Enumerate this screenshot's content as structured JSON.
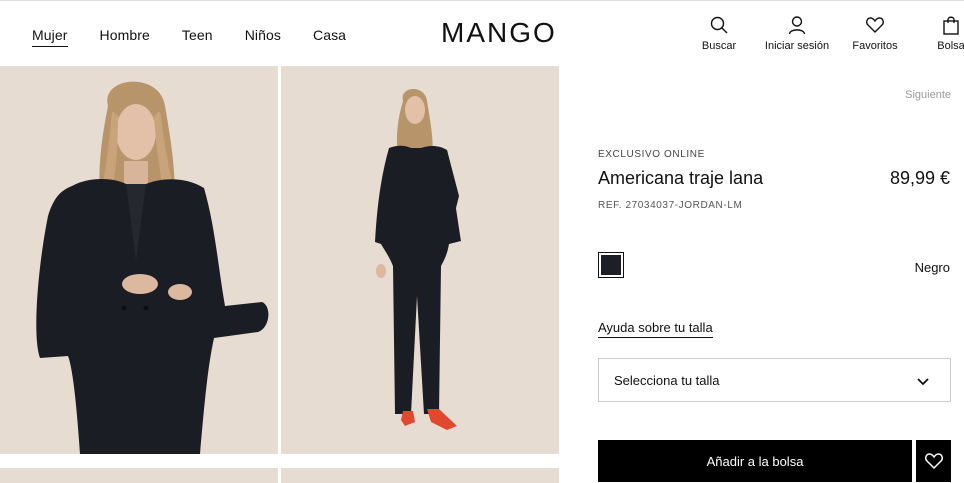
{
  "header": {
    "nav": [
      {
        "label": "Mujer",
        "active": true
      },
      {
        "label": "Hombre"
      },
      {
        "label": "Teen"
      },
      {
        "label": "Niños"
      },
      {
        "label": "Casa"
      }
    ],
    "logo": "MANGO",
    "actions": {
      "search": {
        "label": "Buscar",
        "icon": "search-icon"
      },
      "login": {
        "label": "Iniciar sesión",
        "icon": "user-icon"
      },
      "favorites": {
        "label": "Favoritos",
        "icon": "heart-icon"
      },
      "bag": {
        "label": "Bolsa",
        "icon": "bag-icon"
      }
    }
  },
  "product": {
    "next_label": "Siguiente",
    "badge": "EXCLUSIVO ONLINE",
    "name": "Americana traje lana",
    "price": "89,99 €",
    "ref": "REF. 27034037-JORDAN-LM",
    "color": {
      "name": "Negro",
      "hex": "#1d1f26"
    },
    "size_help": "Ayuda sobre tu talla",
    "size_select": "Selecciona tu talla",
    "add_to_bag": "Añadir a la bolsa"
  },
  "colors": {
    "image_bg": "#e6dcd1",
    "suit": "#1b1d24",
    "shoes": "#e0492c"
  }
}
